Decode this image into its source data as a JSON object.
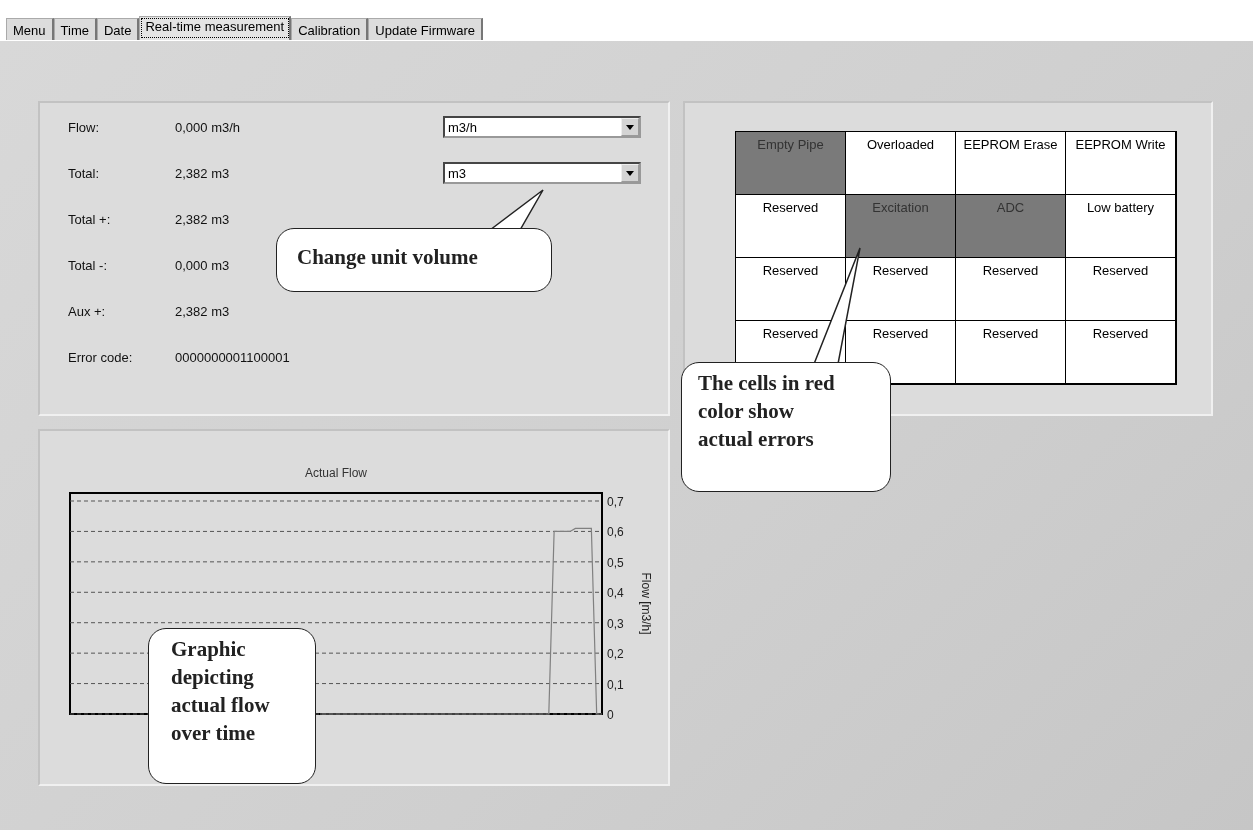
{
  "tabs": [
    {
      "label": "Menu",
      "selected": false
    },
    {
      "label": "Time",
      "selected": false
    },
    {
      "label": "Date",
      "selected": false
    },
    {
      "label": "Real-time measurement",
      "selected": true
    },
    {
      "label": "Calibration",
      "selected": false
    },
    {
      "label": "Update Firmware",
      "selected": false
    }
  ],
  "readings": [
    {
      "label": "Flow:",
      "value": "0,000 m3/h"
    },
    {
      "label": "Total:",
      "value": "2,382 m3"
    },
    {
      "label": "Total +:",
      "value": "2,382 m3"
    },
    {
      "label": "Total -:",
      "value": "0,000 m3"
    },
    {
      "label": "Aux +:",
      "value": "2,382 m3"
    },
    {
      "label": "Error code:",
      "value": "0000000001100001"
    }
  ],
  "unit_selectors": [
    {
      "value": "m3/h"
    },
    {
      "value": "m3"
    }
  ],
  "status_table": {
    "rows": [
      [
        {
          "label": "Empty Pipe",
          "error": true
        },
        {
          "label": "Overloaded",
          "error": false
        },
        {
          "label": "EEPROM Erase",
          "error": false
        },
        {
          "label": "EEPROM Write",
          "error": false
        }
      ],
      [
        {
          "label": "Reserved",
          "error": false
        },
        {
          "label": "Excitation",
          "error": true
        },
        {
          "label": "ADC",
          "error": true
        },
        {
          "label": "Low battery",
          "error": false
        }
      ],
      [
        {
          "label": "Reserved",
          "error": false
        },
        {
          "label": "Reserved",
          "error": false
        },
        {
          "label": "Reserved",
          "error": false
        },
        {
          "label": "Reserved",
          "error": false
        }
      ],
      [
        {
          "label": "Reserved",
          "error": false
        },
        {
          "label": "Reserved",
          "error": false
        },
        {
          "label": "Reserved",
          "error": false
        },
        {
          "label": "Reserved",
          "error": false
        }
      ]
    ]
  },
  "flow_chart": {
    "chart_data": {
      "type": "line",
      "title": "Actual Flow",
      "ylabel": "Flow [m3/h]",
      "ylim": [
        0,
        0.7
      ],
      "yticks": [
        {
          "value": 0,
          "label": "0"
        },
        {
          "value": 0.1,
          "label": "0,1"
        },
        {
          "value": 0.2,
          "label": "0,2"
        },
        {
          "value": 0.3,
          "label": "0,3"
        },
        {
          "value": 0.4,
          "label": "0,4"
        },
        {
          "value": 0.5,
          "label": "0,5"
        },
        {
          "value": 0.6,
          "label": "0,6"
        },
        {
          "value": 0.7,
          "label": "0,7"
        }
      ],
      "grid": true,
      "series": [
        {
          "color": "#808080",
          "values": [
            null,
            null,
            null,
            null,
            null,
            null,
            null,
            null,
            null,
            null,
            null,
            null,
            null,
            null,
            null,
            null,
            null,
            null,
            null,
            null,
            null,
            null,
            null,
            null,
            null,
            null,
            null,
            null,
            null,
            null,
            null,
            null,
            null,
            null,
            null,
            null,
            null,
            null,
            null,
            null,
            null,
            null,
            null,
            null,
            null,
            null,
            null,
            0,
            0,
            0,
            0,
            0,
            0,
            0,
            0,
            0,
            0,
            0,
            0,
            0,
            0,
            0,
            0,
            0,
            0,
            0,
            0,
            0,
            0,
            0,
            0,
            0,
            0,
            0,
            0,
            0,
            0,
            0,
            0,
            0,
            0,
            0,
            0,
            0,
            0,
            0,
            0,
            0,
            0,
            0,
            0,
            0.6,
            0.6,
            0.6,
            0.6,
            0.61,
            0.61,
            0.61,
            0.61,
            0,
            0
          ]
        }
      ]
    }
  },
  "callouts": [
    {
      "text": "Change unit volume"
    },
    {
      "text": "The cells in red color show actual errors"
    },
    {
      "text": "Graphic depicting actual flow over time"
    }
  ]
}
